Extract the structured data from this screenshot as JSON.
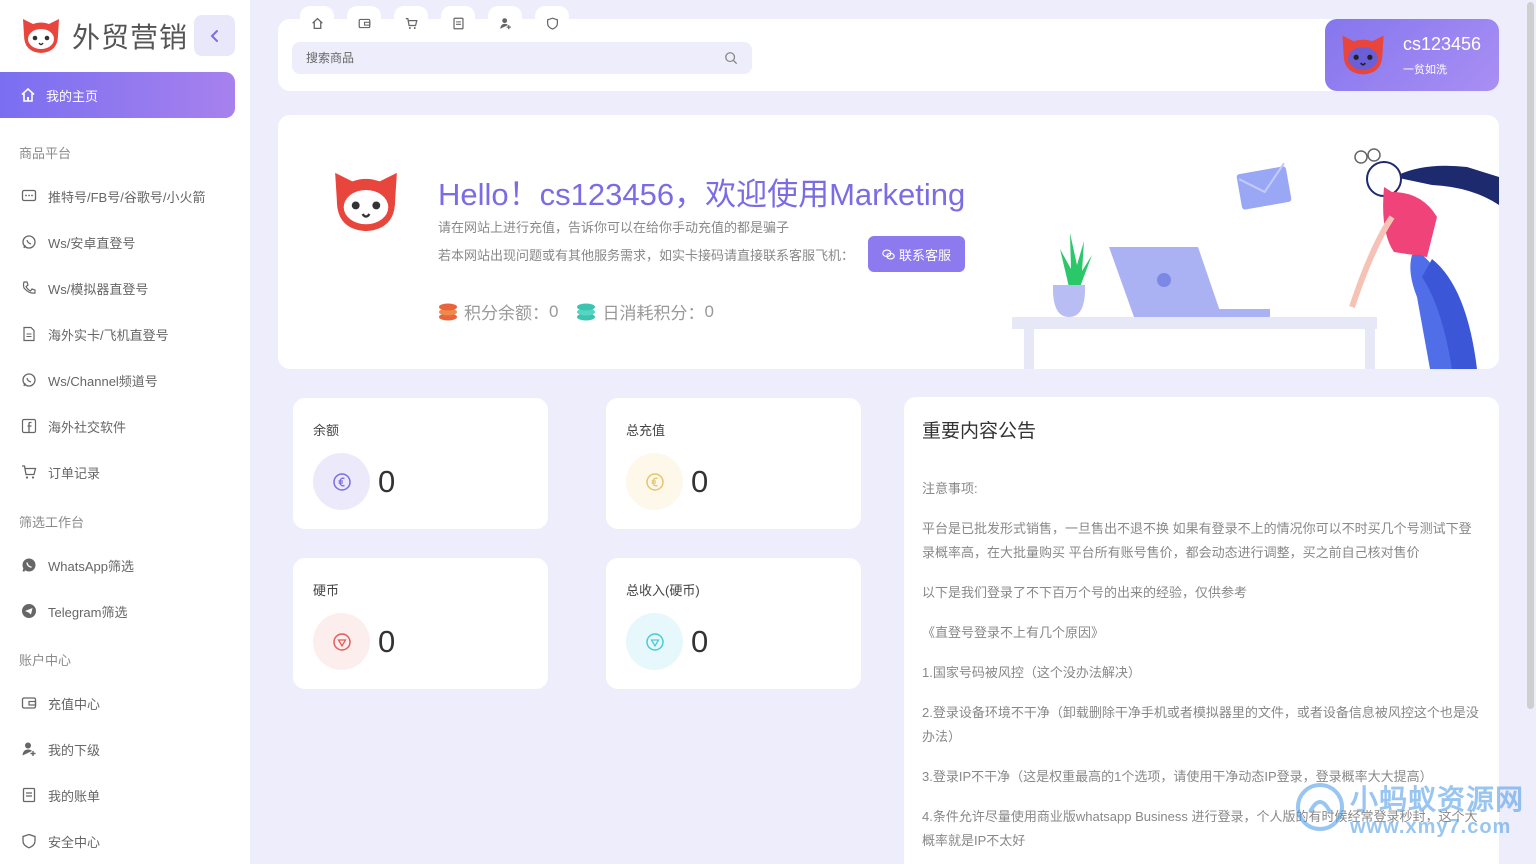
{
  "app": {
    "brand_name": "外贸营销"
  },
  "sidebar": {
    "home_label": "我的主页",
    "sections": [
      {
        "title": "商品平台",
        "items": [
          {
            "label": "推特号/FB号/谷歌号/小火箭",
            "icon": "message-square-icon"
          },
          {
            "label": "Ws/安卓直登号",
            "icon": "whatsapp-icon"
          },
          {
            "label": "Ws/模拟器直登号",
            "icon": "phone-icon"
          },
          {
            "label": "海外实卡/飞机直登号",
            "icon": "document-icon"
          },
          {
            "label": "Ws/Channel频道号",
            "icon": "whatsapp-icon"
          },
          {
            "label": "海外社交软件",
            "icon": "facebook-icon"
          },
          {
            "label": "订单记录",
            "icon": "cart-icon"
          }
        ]
      },
      {
        "title": "筛选工作台",
        "items": [
          {
            "label": "WhatsApp筛选",
            "icon": "whatsapp-filled-icon"
          },
          {
            "label": "Telegram筛选",
            "icon": "telegram-icon"
          }
        ]
      },
      {
        "title": "账户中心",
        "items": [
          {
            "label": "充值中心",
            "icon": "wallet-icon"
          },
          {
            "label": "我的下级",
            "icon": "user-icon"
          },
          {
            "label": "我的账单",
            "icon": "bill-icon"
          },
          {
            "label": "安全中心",
            "icon": "shield-icon"
          }
        ]
      }
    ]
  },
  "topbar": {
    "quick_tabs": [
      "home-icon",
      "wallet-icon",
      "cart-icon",
      "bill-icon",
      "user-icon",
      "shield-icon"
    ],
    "search_placeholder": "搜索商品",
    "user": {
      "name": "cs123456",
      "motto": "一贫如洗"
    }
  },
  "welcome": {
    "title": "Hello！cs123456，欢迎使用Marketing",
    "line1": "请在网站上进行充值，告诉你可以在给你手动充值的都是骗子",
    "line2": "若本网站出现问题或有其他服务需求，如实卡接码请直接联系客服飞机：",
    "contact_button": "联系客服",
    "points_balance_label": "积分余额：",
    "points_balance_value": "0",
    "daily_points_label": "日消耗积分：",
    "daily_points_value": "0"
  },
  "stats": [
    {
      "label": "余额",
      "value": "0",
      "icon": "euro-icon",
      "color": "#7b6ce6",
      "bg": "#ece9fb"
    },
    {
      "label": "总充值",
      "value": "0",
      "icon": "euro-icon",
      "color": "#e9c46a",
      "bg": "#fdf8ea"
    },
    {
      "label": "硬币",
      "value": "0",
      "icon": "coin-icon",
      "color": "#e35d5d",
      "bg": "#fdeeee"
    },
    {
      "label": "总收入(硬币)",
      "value": "0",
      "icon": "coin-icon",
      "color": "#4cc9d9",
      "bg": "#e6f8fb"
    }
  ],
  "notice": {
    "title": "重要内容公告",
    "paragraphs": [
      "注意事项:",
      "平台是已批发形式销售，一旦售出不退不换 如果有登录不上的情况你可以不时买几个号测试下登录概率高，在大批量购买 平台所有账号售价，都会动态进行调整，买之前自己核对售价",
      "以下是我们登录了不下百万个号的出来的经验，仅供参考",
      "《直登号登录不上有几个原因》",
      "1.国家号码被风控（这个没办法解决）",
      "2.登录设备环境不干净（卸载删除干净手机或者模拟器里的文件，或者设备信息被风控这个也是没办法）",
      "3.登录IP不干净（这是权重最高的1个选项，请使用干净动态IP登录，登录概率大大提高）",
      "4.条件允许尽量使用商业版whatsapp Business 进行登录，个人版的有时候经常登录秒封，这个大概率就是IP不太好"
    ]
  },
  "watermark": {
    "line1": "小蚂蚁资源网",
    "line2": "www.xmy7.com"
  },
  "colors": {
    "accent": "#7b6ce6",
    "background": "#eeedfb"
  }
}
